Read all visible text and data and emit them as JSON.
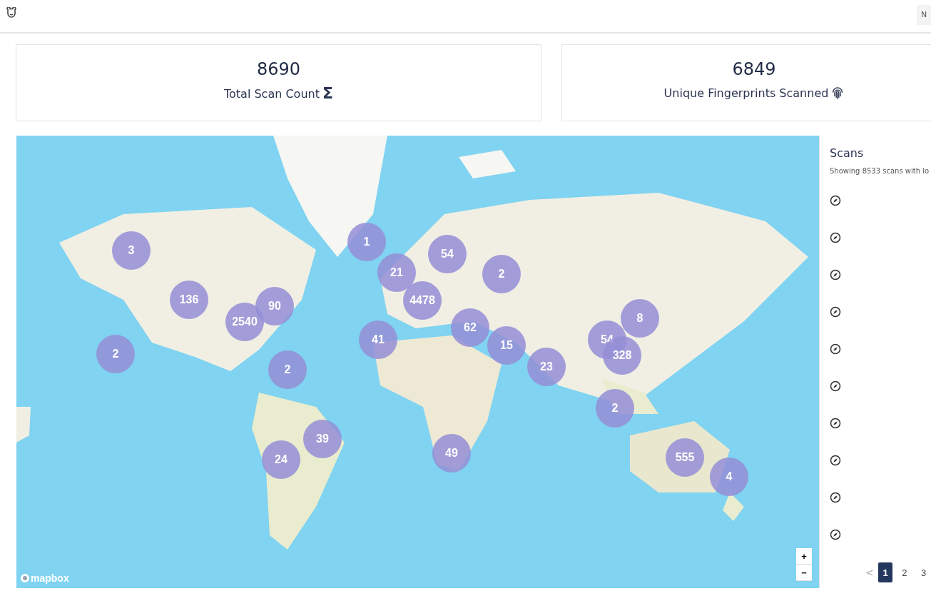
{
  "header": {
    "button_label": "N"
  },
  "stats": [
    {
      "value": "8690",
      "label": "Total Scan Count",
      "kind": "sigma",
      "icon_char": "Σ"
    },
    {
      "value": "6849",
      "label": "Unique Fingerprints Scanned",
      "kind": "fingerprint"
    }
  ],
  "map": {
    "kind": "picture",
    "attribution": "mapbox",
    "zoom_in": "+",
    "zoom_out": "−",
    "clusters": [
      {
        "count": "3"
      },
      {
        "count": "136"
      },
      {
        "count": "2540"
      },
      {
        "count": "90"
      },
      {
        "count": "2"
      },
      {
        "count": "2"
      },
      {
        "count": "1"
      },
      {
        "count": "21"
      },
      {
        "count": "54"
      },
      {
        "count": "2"
      },
      {
        "count": "4478"
      },
      {
        "count": "41"
      },
      {
        "count": "62"
      },
      {
        "count": "15"
      },
      {
        "count": "23"
      },
      {
        "count": "54"
      },
      {
        "count": "8"
      },
      {
        "count": "328"
      },
      {
        "count": "2"
      },
      {
        "count": "39"
      },
      {
        "count": "24"
      },
      {
        "count": "49"
      },
      {
        "count": "555"
      },
      {
        "count": "4"
      }
    ]
  },
  "scans": {
    "title": "Scans",
    "summary": "Showing 8533 scans with lo",
    "items": [
      {
        "kind": "location"
      },
      {
        "kind": "location"
      },
      {
        "kind": "location"
      },
      {
        "kind": "location"
      },
      {
        "kind": "location"
      },
      {
        "kind": "location"
      },
      {
        "kind": "location"
      },
      {
        "kind": "location"
      },
      {
        "kind": "location"
      },
      {
        "kind": "location"
      }
    ],
    "pagination": {
      "prev": "<",
      "pages": [
        {
          "label": "1",
          "selected": true
        },
        {
          "label": "2",
          "selected": false
        },
        {
          "label": "3",
          "selected": false
        }
      ]
    }
  }
}
